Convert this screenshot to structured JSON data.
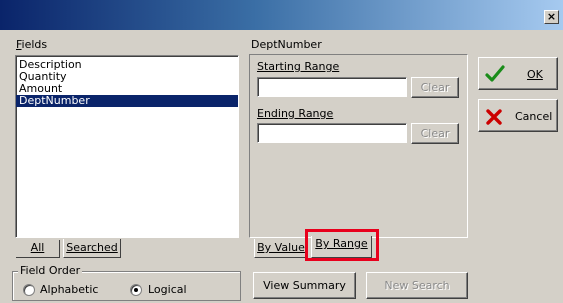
{
  "window": {
    "close_glyph": "×"
  },
  "fields": {
    "label": "Fields",
    "items": [
      {
        "label": "Description",
        "selected": false
      },
      {
        "label": "Quantity",
        "selected": false
      },
      {
        "label": "Amount",
        "selected": false
      },
      {
        "label": "DeptNumber",
        "selected": true
      }
    ]
  },
  "left_tabs": {
    "all": "All",
    "searched": "Searched"
  },
  "field_order": {
    "label": "Field Order",
    "options": [
      {
        "label": "Alphabetic",
        "selected": false
      },
      {
        "label": "Logical",
        "selected": true
      }
    ]
  },
  "criteria": {
    "field_name": "DeptNumber",
    "starting": {
      "label": "Starting Range",
      "value": "",
      "clear_label": "Clear"
    },
    "ending": {
      "label": "Ending Range",
      "value": "",
      "clear_label": "Clear"
    }
  },
  "right_tabs": {
    "by_value": "By Value",
    "by_range": "By Range",
    "highlight_color": "#e8001c"
  },
  "buttons": {
    "ok": "OK",
    "cancel": "Cancel",
    "view_summary": "View Summary",
    "new_search": "New Search"
  },
  "icons": {
    "ok": "checkmark-icon",
    "cancel": "red-x-icon"
  },
  "colors": {
    "face": "#d4d0c8",
    "selection": "#0a246a",
    "check": "#1a8c1a",
    "cross": "#cc0000"
  }
}
